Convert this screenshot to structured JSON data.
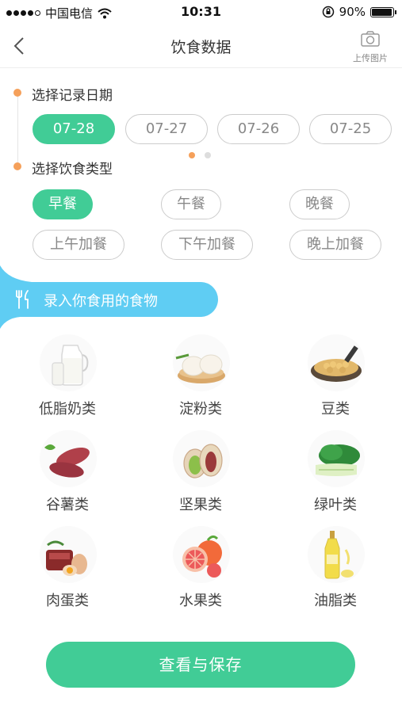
{
  "status": {
    "carrier": "中国电信",
    "time": "10:31",
    "battery_percent": "90%",
    "battery_level": 0.9
  },
  "nav": {
    "title": "饮食数据",
    "upload_label": "上传图片"
  },
  "date_section": {
    "title": "选择记录日期",
    "dates": [
      "07-28",
      "07-27",
      "07-26",
      "07-25"
    ],
    "selected": "07-28"
  },
  "meal_section": {
    "title": "选择饮食类型",
    "types": [
      "早餐",
      "午餐",
      "晚餐",
      "上午加餐",
      "下午加餐",
      "晚上加餐"
    ],
    "selected": "早餐"
  },
  "food_section": {
    "title": "录入你食用的食物",
    "items": [
      {
        "label": "低脂奶类",
        "icon": "milk-icon"
      },
      {
        "label": "淀粉类",
        "icon": "bun-icon"
      },
      {
        "label": "豆类",
        "icon": "soybean-icon"
      },
      {
        "label": "谷薯类",
        "icon": "sweet-potato-icon"
      },
      {
        "label": "坚果类",
        "icon": "pistachio-icon"
      },
      {
        "label": "绿叶类",
        "icon": "leafy-greens-icon"
      },
      {
        "label": "肉蛋类",
        "icon": "meat-egg-icon"
      },
      {
        "label": "水果类",
        "icon": "grapefruit-icon"
      },
      {
        "label": "油脂类",
        "icon": "oil-bottle-icon"
      }
    ]
  },
  "save_button": {
    "label": "查看与保存"
  },
  "colors": {
    "accent_green": "#41cc96",
    "banner_blue": "#5fcdf3",
    "timeline_orange": "#f5a05a"
  }
}
